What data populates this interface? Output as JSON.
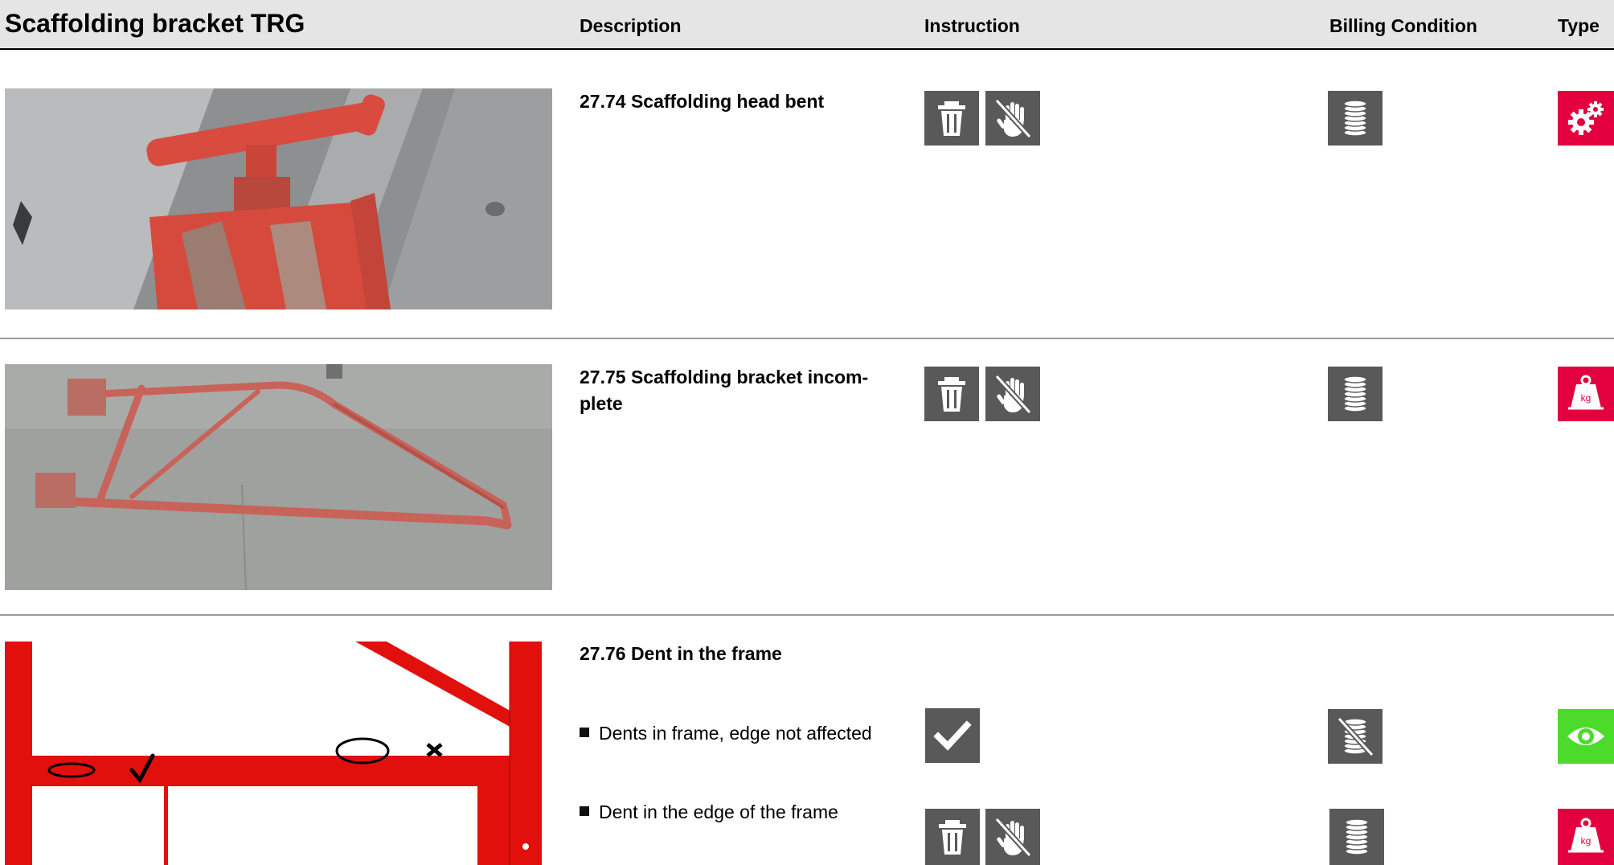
{
  "header": {
    "title": "Scaffolding bracket TRG",
    "columns": {
      "description": "Description",
      "instruction": "Instruction",
      "billing": "Billing Condition",
      "type": "Type"
    }
  },
  "rows": [
    {
      "title": "27.74 Scaffolding head bent",
      "image": "scaffolding-head-bent-photo",
      "instruction_icons": [
        "trash-icon",
        "no-hand-icon"
      ],
      "billing_icon": "coins-icon",
      "type_icon": "gears-icon"
    },
    {
      "title": "27.75 Scaffolding bracket incom-plete",
      "image": "scaffolding-bracket-incomplete-photo",
      "instruction_icons": [
        "trash-icon",
        "no-hand-icon"
      ],
      "billing_icon": "coins-icon",
      "type_icon": "weight-kg-icon"
    },
    {
      "title": "27.76 Dent in the frame",
      "image": "frame-dent-diagram",
      "items": [
        {
          "text": "Dents in frame, edge not affected",
          "instruction_icons": [
            "checkmark-icon"
          ],
          "billing_icon": "no-coins-icon",
          "type_icon": "eye-icon"
        },
        {
          "text": "Dent in the edge of the frame",
          "instruction_icons": [
            "trash-icon",
            "no-hand-icon"
          ],
          "billing_icon": "coins-icon",
          "type_icon": "weight-kg-icon"
        }
      ]
    }
  ],
  "weight_label": "kg",
  "colors": {
    "header_bg": "#e5e5e5",
    "icon_gray": "#595959",
    "type_red": "#e3003e",
    "type_green": "#4cdb2a",
    "frame_red": "#e2100c"
  }
}
